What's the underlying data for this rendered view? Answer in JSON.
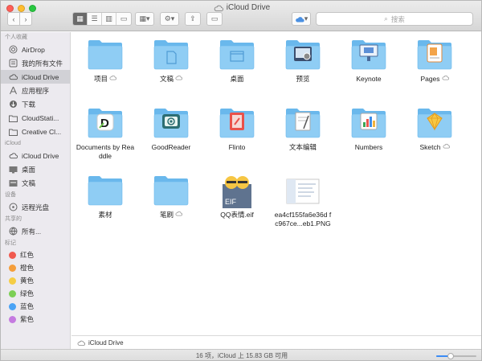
{
  "window": {
    "title": "iCloud Drive"
  },
  "toolbar": {
    "search_placeholder": "搜索",
    "view_active": "icon"
  },
  "sidebar": {
    "sections": [
      {
        "header": "个人收藏",
        "items": [
          {
            "label": "AirDrop",
            "icon": "airdrop-icon"
          },
          {
            "label": "我的所有文件",
            "icon": "all-files-icon"
          },
          {
            "label": "iCloud Drive",
            "icon": "cloud-icon",
            "selected": true
          },
          {
            "label": "应用程序",
            "icon": "applications-icon"
          },
          {
            "label": "下载",
            "icon": "download-icon"
          },
          {
            "label": "CloudStati...",
            "icon": "folder-icon"
          },
          {
            "label": "Creative Cl...",
            "icon": "creative-cloud-icon"
          }
        ]
      },
      {
        "header": "iCloud",
        "items": [
          {
            "label": "iCloud Drive",
            "icon": "cloud-icon"
          },
          {
            "label": "桌面",
            "icon": "desktop-icon"
          },
          {
            "label": "文稿",
            "icon": "documents-icon"
          }
        ]
      },
      {
        "header": "设备",
        "items": [
          {
            "label": "远程光盘",
            "icon": "disc-icon"
          }
        ]
      },
      {
        "header": "共享的",
        "items": [
          {
            "label": "所有...",
            "icon": "network-icon"
          }
        ]
      },
      {
        "header": "标记",
        "tags": [
          {
            "label": "红色",
            "color": "#f05a4f"
          },
          {
            "label": "橙色",
            "color": "#f59e3b"
          },
          {
            "label": "黄色",
            "color": "#f5cd45"
          },
          {
            "label": "绿色",
            "color": "#7ccf55"
          },
          {
            "label": "蓝色",
            "color": "#4aa3f5"
          },
          {
            "label": "紫色",
            "color": "#c57be0"
          }
        ]
      }
    ]
  },
  "files": [
    {
      "name": "项目",
      "kind": "folder",
      "cloud": true
    },
    {
      "name": "文稿",
      "kind": "folder-docs",
      "cloud": true
    },
    {
      "name": "桌面",
      "kind": "folder-desktop",
      "cloud": false
    },
    {
      "name": "预览",
      "kind": "app-preview",
      "cloud": false
    },
    {
      "name": "Keynote",
      "kind": "app-keynote",
      "cloud": false
    },
    {
      "name": "Pages",
      "kind": "app-pages",
      "cloud": true
    },
    {
      "name": "Documents by Readdle",
      "kind": "app-documents",
      "cloud": false
    },
    {
      "name": "GoodReader",
      "kind": "app-goodreader",
      "cloud": false
    },
    {
      "name": "Flinto",
      "kind": "app-flinto",
      "cloud": false
    },
    {
      "name": "文本编辑",
      "kind": "app-textedit",
      "cloud": false
    },
    {
      "name": "Numbers",
      "kind": "app-numbers",
      "cloud": false
    },
    {
      "name": "Sketch",
      "kind": "app-sketch",
      "cloud": true
    },
    {
      "name": "素材",
      "kind": "folder",
      "cloud": false
    },
    {
      "name": "笔刷",
      "kind": "folder",
      "cloud": true
    },
    {
      "name": "QQ表情.eif",
      "kind": "file-eif",
      "cloud": false
    },
    {
      "name": "ea4cf155fa6e36d fc967ce...eb1.PNG",
      "kind": "file-png",
      "cloud": false
    }
  ],
  "pathbar": {
    "label": "iCloud Drive"
  },
  "status": {
    "text": "16 项，iCloud 上 15.83 GB 可用"
  },
  "zoom": {
    "level": 0.35
  },
  "colors": {
    "folder": "#6ab8ec",
    "folder_light": "#8fcdf4",
    "selected": "#d1d1d6",
    "accent": "#3b8cf5"
  }
}
